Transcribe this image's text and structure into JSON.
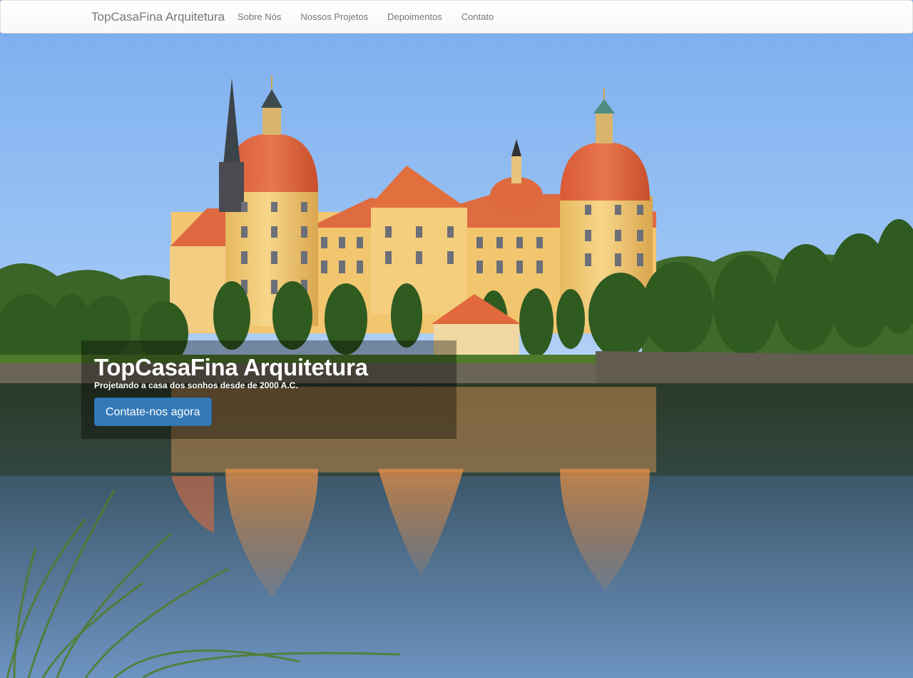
{
  "navbar": {
    "brand": "TopCasaFina Arquitetura",
    "items": [
      {
        "label": "Sobre Nós"
      },
      {
        "label": "Nossos Projetos"
      },
      {
        "label": "Depoimentos"
      },
      {
        "label": "Contato"
      }
    ]
  },
  "hero": {
    "title": "TopCasaFina Arquitetura",
    "subtitle": "Projetando a casa dos sonhos desde de 2000 A.C.",
    "cta_label": "Contate-nos agora",
    "image_subject": "castle-by-lake-photo"
  },
  "colors": {
    "primary": "#337ab7",
    "navbar_bg": "#f8f8f8",
    "nav_text": "#777777",
    "sky": "#8ab9f2",
    "roof": "#e06a3e",
    "facade": "#f0c46a",
    "water": "#4d6f92"
  }
}
